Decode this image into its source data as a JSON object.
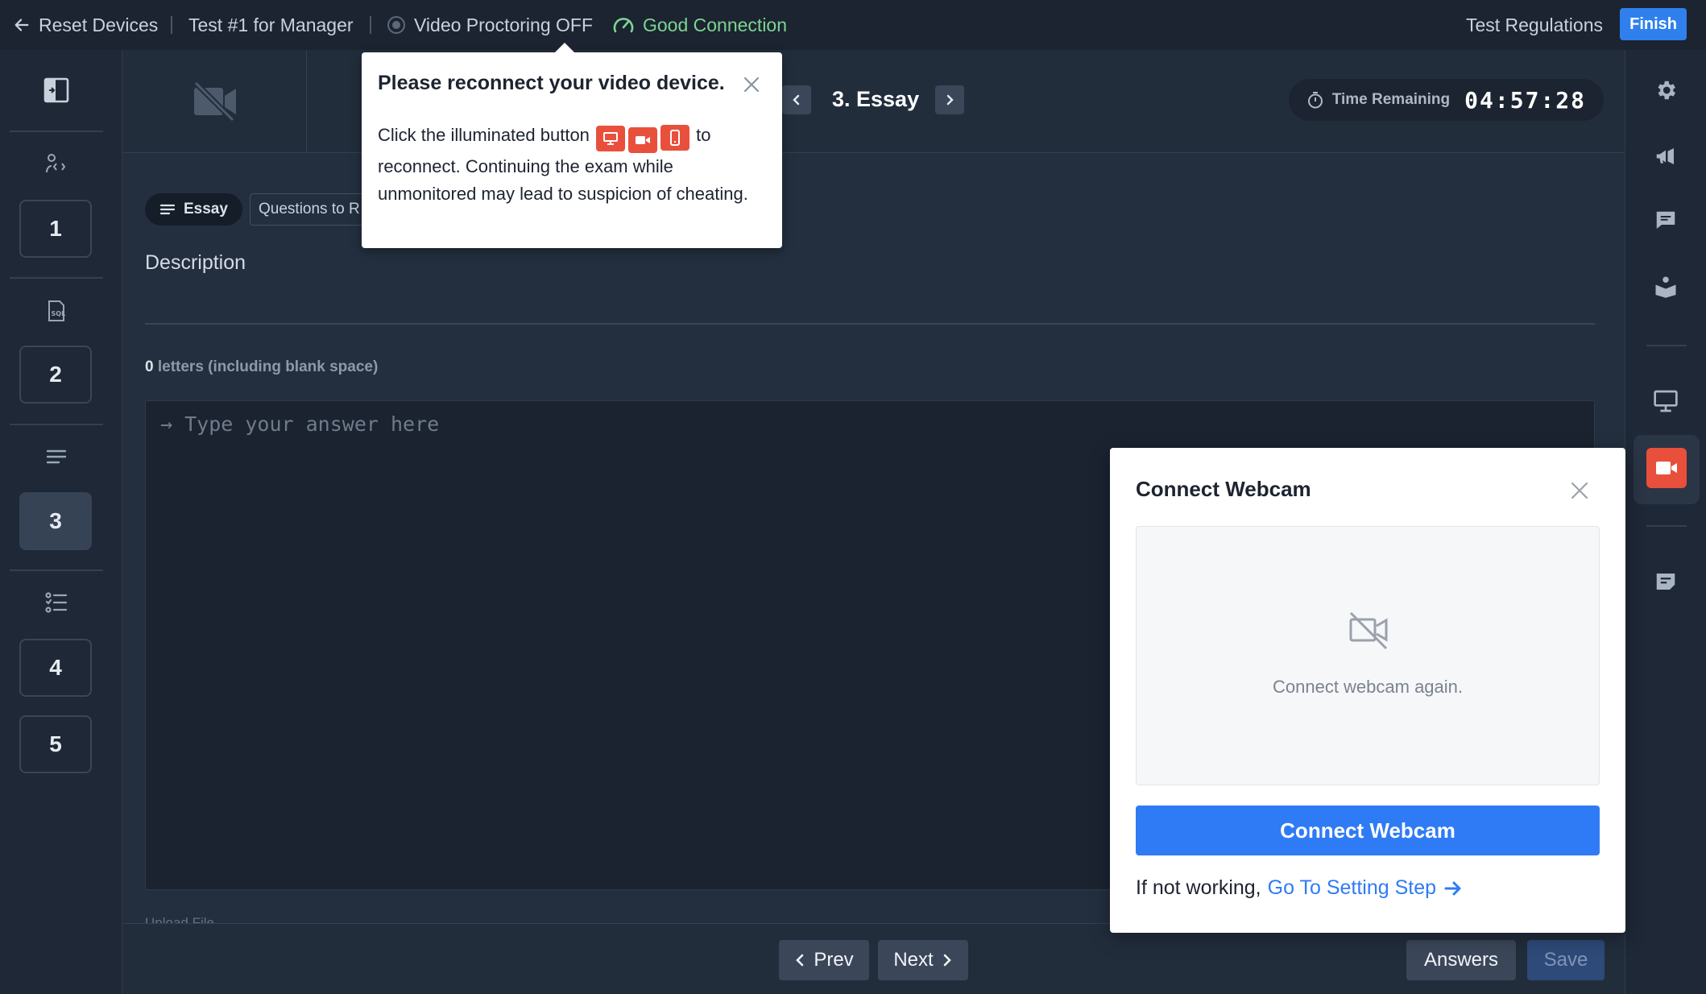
{
  "topbar": {
    "back_label": "Reset Devices",
    "test_name": "Test #1 for Manager",
    "proctoring_status": "Video Proctoring OFF",
    "connection_status": "Good Connection",
    "regulations_label": "Test Regulations",
    "finish_label": "Finish"
  },
  "sidebar": {
    "questions": [
      {
        "number": "1",
        "type_icon": "coding-icon"
      },
      {
        "number": "2",
        "type_icon": "sql-icon"
      },
      {
        "number": "3",
        "type_icon": "essay-lines-icon",
        "active": true
      },
      {
        "number": "4",
        "type_icon": "checklist-icon"
      },
      {
        "number": "5"
      }
    ]
  },
  "header": {
    "question_title": "3. Essay",
    "timer_label": "Time Remaining",
    "timer_value": "04:57:28"
  },
  "question": {
    "type_tag": "Essay",
    "secondary_tag": "Questions to R",
    "description_label": "Description",
    "letter_count": "0",
    "letter_count_suffix": " letters (including blank space)",
    "answer_placeholder": "→ Type your answer here",
    "upload_label": "Upload File"
  },
  "footer": {
    "prev_label": "Prev",
    "next_label": "Next",
    "answers_label": "Answers",
    "save_label": "Save"
  },
  "reconnect_popover": {
    "title": "Please reconnect your video device.",
    "body_before": "Click the illuminated button",
    "body_after_icons": "to",
    "body_rest": "reconnect. Continuing the exam while unmonitored may lead to suspicion of cheating."
  },
  "webcam_modal": {
    "title": "Connect Webcam",
    "preview_text": "Connect webcam again.",
    "connect_label": "Connect Webcam",
    "footer_text": "If not working,",
    "link_label": "Go To Setting Step"
  },
  "colors": {
    "accent_blue": "#2f7bf5",
    "alert_red": "#e9503c",
    "good_green": "#7ed492",
    "background": "#232f3f"
  }
}
